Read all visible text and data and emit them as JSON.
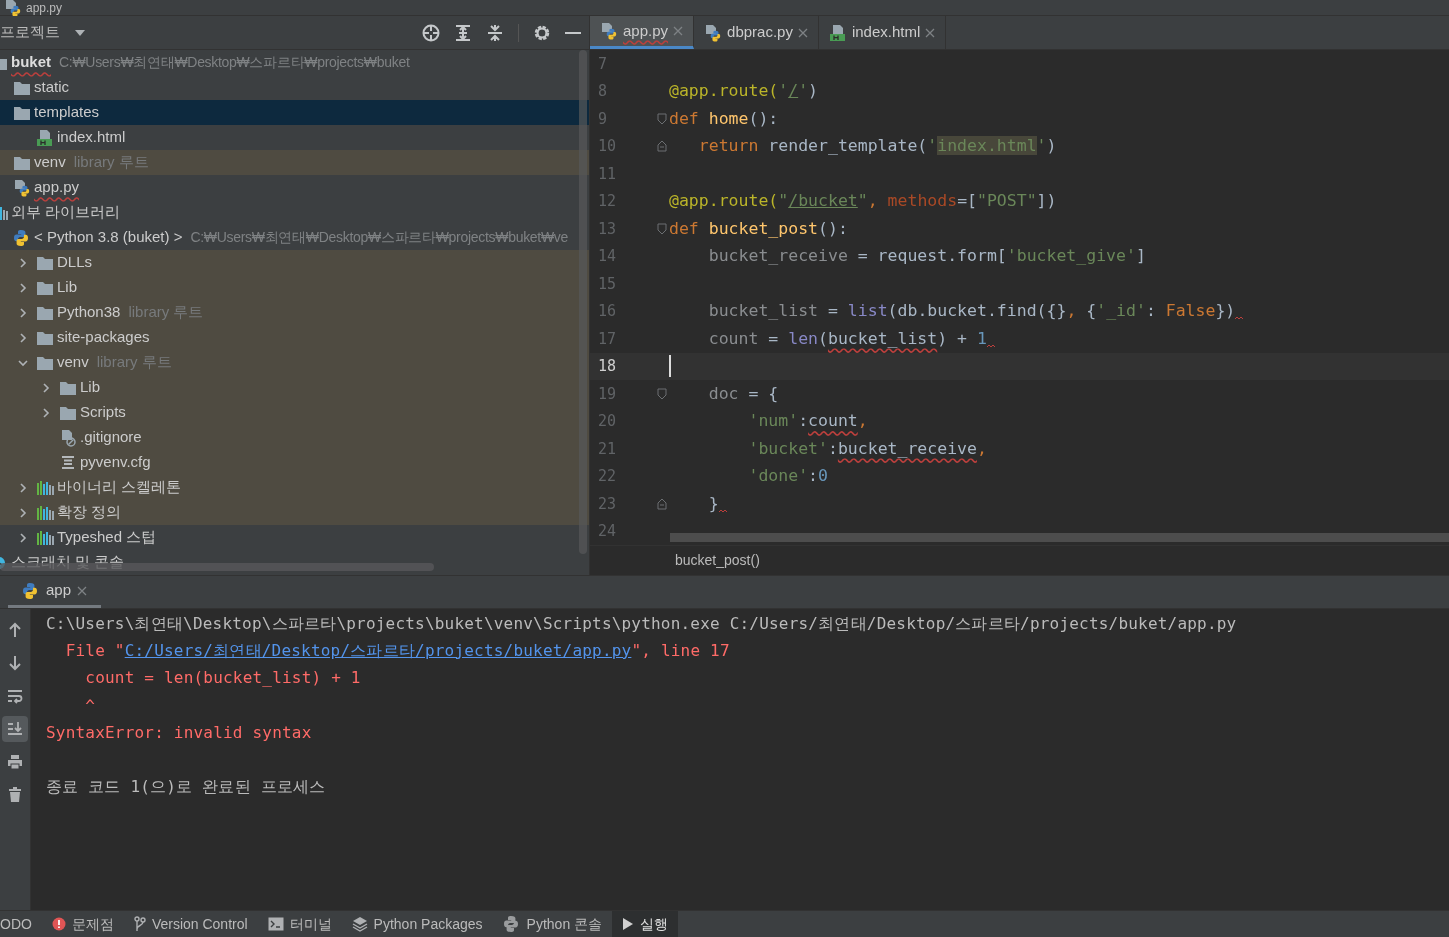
{
  "title_bar": {
    "file": "app.py"
  },
  "project_panel": {
    "title": "프로젝트",
    "tree": [
      {
        "label": "buket",
        "kind": "project",
        "path": "C:₩Users₩최연태₩Desktop₩스파르타₩projects₩buket",
        "selected": false,
        "tinted": false,
        "errors": true,
        "children": [
          {
            "label": "static",
            "kind": "folder",
            "selected": false,
            "tinted": false,
            "errors": false
          },
          {
            "label": "templates",
            "kind": "folder",
            "selected": true,
            "tinted": false,
            "errors": false,
            "children": [
              {
                "label": "index.html",
                "kind": "html",
                "selected": false,
                "tinted": false,
                "errors": false
              }
            ]
          },
          {
            "label": "venv",
            "kind": "folder",
            "hint": "library 루트",
            "selected": false,
            "tinted": true,
            "errors": false
          },
          {
            "label": "app.py",
            "kind": "python-file",
            "selected": false,
            "tinted": false,
            "errors": true
          }
        ]
      },
      {
        "label": "외부 라이브러리",
        "kind": "library",
        "selected": false,
        "tinted": false,
        "errors": false,
        "children": [
          {
            "label": "< Python 3.8 (buket) >",
            "kind": "sdk",
            "path": "C:₩Users₩최연태₩Desktop₩스파르타₩projects₩buket₩ve",
            "selected": false,
            "tinted": false,
            "errors": false,
            "children": [
              {
                "label": "DLLs",
                "kind": "folder",
                "expanded": false,
                "selected": false,
                "tinted": true,
                "errors": false
              },
              {
                "label": "Lib",
                "kind": "folder",
                "expanded": false,
                "selected": false,
                "tinted": true,
                "errors": false
              },
              {
                "label": "Python38",
                "kind": "folder",
                "hint": "library 루트",
                "expanded": false,
                "selected": false,
                "tinted": true,
                "errors": false
              },
              {
                "label": "site-packages",
                "kind": "folder",
                "expanded": false,
                "selected": false,
                "tinted": true,
                "errors": false
              },
              {
                "label": "venv",
                "kind": "folder",
                "hint": "library 루트",
                "expanded": true,
                "selected": false,
                "tinted": true,
                "errors": false,
                "children": [
                  {
                    "label": "Lib",
                    "kind": "folder",
                    "expanded": false,
                    "selected": false,
                    "tinted": true,
                    "errors": false
                  },
                  {
                    "label": "Scripts",
                    "kind": "folder",
                    "expanded": false,
                    "selected": false,
                    "tinted": true,
                    "errors": false
                  },
                  {
                    "label": ".gitignore",
                    "kind": "ignore",
                    "selected": false,
                    "tinted": true,
                    "errors": false
                  },
                  {
                    "label": "pyvenv.cfg",
                    "kind": "config",
                    "selected": false,
                    "tinted": true,
                    "errors": false
                  }
                ]
              },
              {
                "label": "바이너리 스켈레톤",
                "kind": "library",
                "expanded": false,
                "selected": false,
                "tinted": true,
                "errors": false
              },
              {
                "label": "확장 정의",
                "kind": "library",
                "expanded": false,
                "selected": false,
                "tinted": true,
                "errors": false
              },
              {
                "label": "Typeshed 스텁",
                "kind": "library",
                "expanded": false,
                "selected": false,
                "tinted": false,
                "errors": false
              }
            ]
          }
        ]
      },
      {
        "label": "스크래치 및 콘솔",
        "kind": "scratch",
        "selected": false,
        "tinted": false,
        "errors": false
      }
    ]
  },
  "editor": {
    "tabs": [
      {
        "label": "app.py",
        "kind": "python-file",
        "selected": true,
        "errors": true
      },
      {
        "label": "dbprac.py",
        "kind": "python-file",
        "selected": false,
        "errors": false
      },
      {
        "label": "index.html",
        "kind": "html",
        "selected": false,
        "errors": false
      }
    ],
    "lines": [
      {
        "number": "7",
        "current": false
      },
      {
        "number": "8",
        "current": false,
        "tokens": [
          {
            "text": "@app.route(",
            "kind": "deco"
          },
          {
            "text": "'",
            "kind": "str"
          },
          {
            "text": "/",
            "kind": "url"
          },
          {
            "text": "'",
            "kind": "str"
          },
          {
            "text": ")",
            "kind": "plain"
          }
        ]
      },
      {
        "number": "9",
        "current": false,
        "fold_start": true,
        "tokens": [
          {
            "text": "def ",
            "kind": "kw"
          },
          {
            "text": "home",
            "kind": "fn"
          },
          {
            "text": "():",
            "kind": "plain"
          }
        ]
      },
      {
        "number": "10",
        "current": false,
        "fold_end": true,
        "tokens": [
          {
            "text": "   return",
            "kind": "kw"
          },
          {
            "text": " render_template(",
            "kind": "plain"
          },
          {
            "text": "'",
            "kind": "str"
          },
          {
            "text": "index.html",
            "kind": "strhl"
          },
          {
            "text": "'",
            "kind": "str"
          },
          {
            "text": ")",
            "kind": "plain"
          }
        ]
      },
      {
        "number": "11",
        "current": false
      },
      {
        "number": "12",
        "current": false,
        "tokens": [
          {
            "text": "@app.route(",
            "kind": "deco"
          },
          {
            "text": "\"",
            "kind": "str"
          },
          {
            "text": "/bucket",
            "kind": "url"
          },
          {
            "text": "\"",
            "kind": "str"
          },
          {
            "text": ", ",
            "kind": "kw"
          },
          {
            "text": "methods",
            "kind": "param"
          },
          {
            "text": "=[",
            "kind": "plain"
          },
          {
            "text": "\"POST\"",
            "kind": "str"
          },
          {
            "text": "])",
            "kind": "plain"
          }
        ]
      },
      {
        "number": "13",
        "current": false,
        "fold_start": true,
        "tokens": [
          {
            "text": "def ",
            "kind": "kw"
          },
          {
            "text": "bucket_post",
            "kind": "fn"
          },
          {
            "text": "():",
            "kind": "plain"
          }
        ]
      },
      {
        "number": "14",
        "current": false,
        "tokens": [
          {
            "text": "    bucket_receive",
            "kind": "var"
          },
          {
            "text": " = request.form[",
            "kind": "plain"
          },
          {
            "text": "'bucket_give'",
            "kind": "str"
          },
          {
            "text": "]",
            "kind": "plain"
          }
        ]
      },
      {
        "number": "15",
        "current": false
      },
      {
        "number": "16",
        "current": false,
        "tokens": [
          {
            "text": "    bucket_list",
            "kind": "var"
          },
          {
            "text": " = ",
            "kind": "plain"
          },
          {
            "text": "list",
            "kind": "builtin"
          },
          {
            "text": "(db.bucket.find({}",
            "kind": "plain"
          },
          {
            "text": ", ",
            "kind": "kw"
          },
          {
            "text": "{",
            "kind": "plain"
          },
          {
            "text": "'_id'",
            "kind": "str"
          },
          {
            "text": ": ",
            "kind": "plain"
          },
          {
            "text": "False",
            "kind": "kw"
          },
          {
            "text": "})",
            "kind": "plain",
            "wavy_after": true
          }
        ]
      },
      {
        "number": "17",
        "current": false,
        "tokens": [
          {
            "text": "    count",
            "kind": "var"
          },
          {
            "text": " = ",
            "kind": "plain"
          },
          {
            "text": "len",
            "kind": "builtin"
          },
          {
            "text": "(",
            "kind": "plain"
          },
          {
            "text": "bucket_list",
            "kind": "plain",
            "wavy_under": true
          },
          {
            "text": ") + ",
            "kind": "plain"
          },
          {
            "text": "1",
            "kind": "num",
            "wavy_after": true
          }
        ]
      },
      {
        "number": "18",
        "current": true
      },
      {
        "number": "19",
        "current": false,
        "fold_start": true,
        "tokens": [
          {
            "text": "    doc",
            "kind": "var"
          },
          {
            "text": " = {",
            "kind": "plain"
          }
        ]
      },
      {
        "number": "20",
        "current": false,
        "tokens": [
          {
            "text": "        'num'",
            "kind": "str"
          },
          {
            "text": ":",
            "kind": "plain"
          },
          {
            "text": "count",
            "kind": "plain",
            "wavy_under": true
          },
          {
            "text": ",",
            "kind": "kw"
          }
        ]
      },
      {
        "number": "21",
        "current": false,
        "tokens": [
          {
            "text": "        'bucket'",
            "kind": "str"
          },
          {
            "text": ":",
            "kind": "plain"
          },
          {
            "text": "bucket_receive",
            "kind": "plain",
            "wavy_under": true
          },
          {
            "text": ",",
            "kind": "kw"
          }
        ]
      },
      {
        "number": "22",
        "current": false,
        "tokens": [
          {
            "text": "        'done'",
            "kind": "str"
          },
          {
            "text": ":",
            "kind": "plain"
          },
          {
            "text": "0",
            "kind": "num"
          }
        ]
      },
      {
        "number": "23",
        "current": false,
        "fold_end": true,
        "tokens": [
          {
            "text": "    }",
            "kind": "plain",
            "wavy_after": true
          }
        ]
      },
      {
        "number": "24",
        "current": false
      }
    ],
    "breadcrumb": "bucket_post()"
  },
  "run_panel": {
    "tabs": [
      {
        "label": "app",
        "selected": true
      }
    ],
    "toolbar": [
      {
        "kind": "up",
        "selected": false
      },
      {
        "kind": "down",
        "selected": false
      },
      {
        "kind": "wrap",
        "selected": false
      },
      {
        "kind": "scroll-end",
        "selected": true
      },
      {
        "kind": "print",
        "selected": false
      },
      {
        "kind": "trash",
        "selected": false
      }
    ],
    "output": [
      {
        "segments": [
          {
            "text": "C:\\Users\\최연태\\Desktop\\스파르타\\projects\\buket\\venv\\Scripts\\python.exe C:/Users/최연태/Desktop/스파르타/projects/buket/app.py",
            "kind": "out"
          }
        ]
      },
      {
        "segments": [
          {
            "text": "  File \"",
            "kind": "err"
          },
          {
            "text": "C:/Users/최연태/Desktop/스파르타/projects/buket/app.py",
            "kind": "link"
          },
          {
            "text": "\", line 17",
            "kind": "err"
          }
        ]
      },
      {
        "segments": [
          {
            "text": "    count = len(bucket_list) + 1",
            "kind": "err"
          }
        ]
      },
      {
        "segments": [
          {
            "text": "    ^",
            "kind": "err"
          }
        ]
      },
      {
        "segments": [
          {
            "text": "SyntaxError: invalid syntax",
            "kind": "err"
          }
        ]
      }
    ],
    "exit_message": "종료 코드 1(으)로 완료된 프로세스"
  },
  "status_bar": [
    {
      "label": "ODO",
      "kind": "todo",
      "selected": false
    },
    {
      "label": "문제점",
      "kind": "problems",
      "selected": false
    },
    {
      "label": "Version Control",
      "kind": "vcs",
      "selected": false
    },
    {
      "label": "터미널",
      "kind": "terminal",
      "selected": false
    },
    {
      "label": "Python Packages",
      "kind": "packages",
      "selected": false
    },
    {
      "label": "Python 콘솔",
      "kind": "python",
      "selected": false
    },
    {
      "label": "실행",
      "kind": "run",
      "selected": true
    }
  ]
}
